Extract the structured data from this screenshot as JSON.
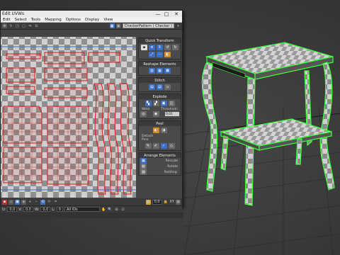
{
  "window": {
    "title": "Edit UVWs",
    "menu": [
      "Edit",
      "Select",
      "Tools",
      "Mapping",
      "Options",
      "Display",
      "View"
    ],
    "checker_combo": "CheckerPattern  ( Checker )",
    "minimize": "—",
    "maximize": "□",
    "close": "✕"
  },
  "panel": {
    "quick_transform": "Quick Transform",
    "reshape": "Reshape Elements",
    "stitch": "Stitch",
    "explode": "Explode",
    "weld": "Weld",
    "threshold": "Threshold:",
    "threshold_value": "0,01",
    "peel": "Peel",
    "detach": "Detach",
    "pins": "Pins:",
    "arrange": "Arrange Elements",
    "rescale": "Rescale",
    "rotate": "Rotate",
    "padding": "Padding:"
  },
  "bottom": {
    "u_label": "U:",
    "v_label": "V:",
    "w_label": "W:",
    "u_value": "0,0",
    "v_value": "0,0",
    "w_value": "0,0",
    "l_label": "L:",
    "l_value": "0",
    "zoom": "0,0",
    "xy": "XY",
    "all_ids": "All IDs"
  },
  "colors": {
    "uv_wire": "#e01818",
    "selection": "#3cff3c",
    "accent_blue": "#3b6fc4"
  }
}
